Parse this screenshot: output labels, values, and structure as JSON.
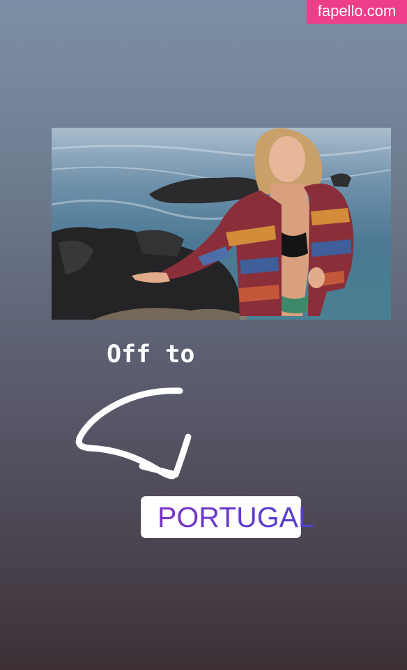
{
  "watermark": {
    "text": "fapello.com",
    "color": "#ee3d89"
  },
  "story": {
    "caption": "Off to",
    "location_sticker": {
      "icon": "location-pin-icon",
      "label": "PORTUGAL",
      "gradient": [
        "#7b32c9",
        "#4f40d1"
      ]
    },
    "drawing": "arrow-doodle-icon"
  }
}
